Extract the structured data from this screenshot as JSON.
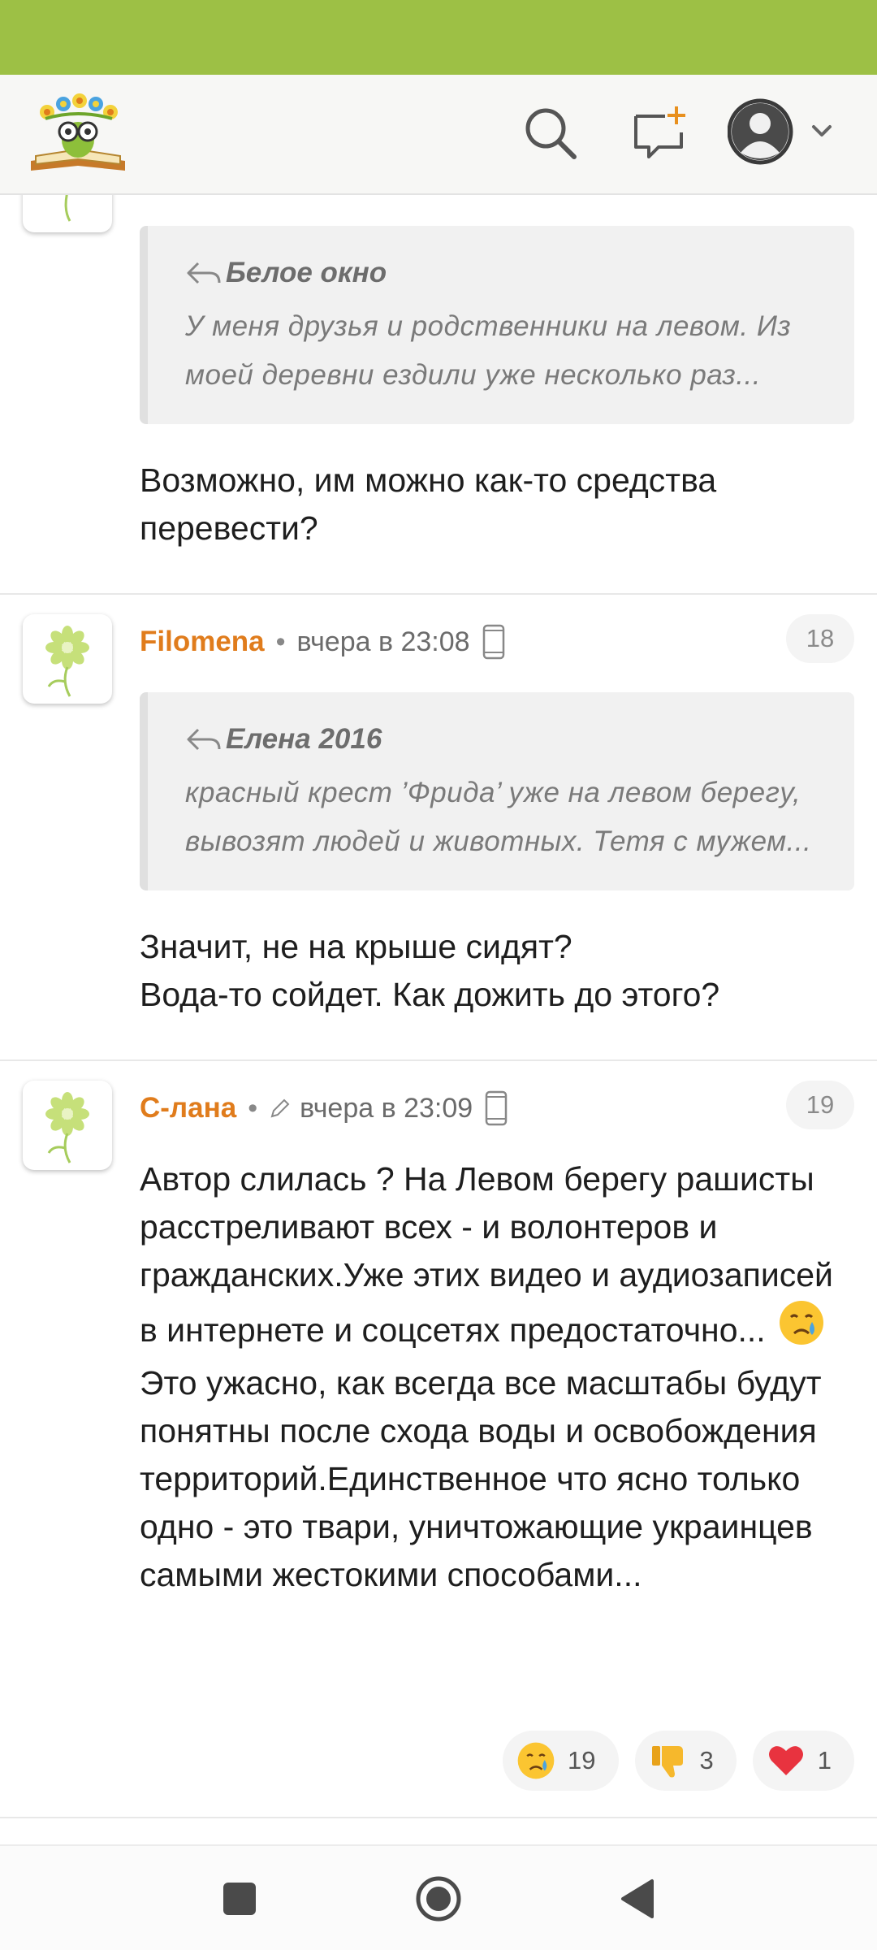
{
  "colors": {
    "status_bar": "#9dc045",
    "author": "#e07c1c",
    "quote_bg": "#f1f1f1"
  },
  "header": {
    "logo_icon": "flower-book-logo",
    "search_icon": "search-icon",
    "new_topic_icon": "chat-plus-icon",
    "profile_icon": "user-avatar-icon"
  },
  "comments": [
    {
      "quote": {
        "author": "Белое окно",
        "text": "У меня друзья и родственники на левом. Из моей деревни ездили уже несколько раз..."
      },
      "text": "Возможно, им можно как-то средства перевести?"
    },
    {
      "author": "Filomena",
      "time": "вчера в 23:08",
      "number": "18",
      "quote": {
        "author": "Елена 2016",
        "text": "красный крест ’Фрида’ уже на левом берегу, вывозят людей и животных. Тетя с мужем..."
      },
      "text_line1": "Значит, не на крыше сидят?",
      "text_line2": "Вода-то сойдет. Как дожить до этого?"
    },
    {
      "author": "С-лана",
      "time": "вчера в 23:09",
      "number": "19",
      "text_part1": "Автор слилась ? На Левом берегу рашисты расстреливают всех - и волонтеров и гражданских.Уже этих видео и аудиозаписей в интернете и соцсетях предостаточно...",
      "text_part2": "Это ужасно, как всегда все масштабы будут понятны после схода воды и освобождения территорий.Единственное что ясно только одно - это твари, уничтожающие украинцев самыми жестокими способами...",
      "reactions": [
        {
          "icon": "crying-face-icon",
          "count": "19"
        },
        {
          "icon": "thumbs-down-icon",
          "count": "3"
        },
        {
          "icon": "heart-icon",
          "count": "1"
        }
      ]
    }
  ],
  "nav": {
    "recents_icon": "square-icon",
    "home_icon": "circle-icon",
    "back_icon": "triangle-back-icon"
  }
}
